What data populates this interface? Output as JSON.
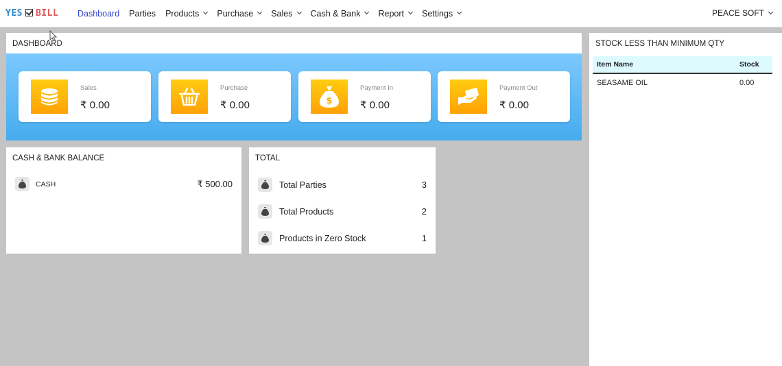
{
  "brand": {
    "yes": "YES",
    "bill": "BILL"
  },
  "nav": {
    "items": [
      {
        "label": "Dashboard",
        "dropdown": false,
        "active": true
      },
      {
        "label": "Parties",
        "dropdown": false,
        "active": false
      },
      {
        "label": "Products",
        "dropdown": true,
        "active": false
      },
      {
        "label": "Purchase",
        "dropdown": true,
        "active": false
      },
      {
        "label": "Sales",
        "dropdown": true,
        "active": false
      },
      {
        "label": "Cash & Bank",
        "dropdown": true,
        "active": false
      },
      {
        "label": "Report",
        "dropdown": true,
        "active": false
      },
      {
        "label": "Settings",
        "dropdown": true,
        "active": false
      }
    ],
    "company": "PEACE SOFT"
  },
  "dashboard": {
    "title": "DASHBOARD",
    "cards": [
      {
        "label": "Sales",
        "value": "₹ 0.00",
        "icon": "coins-stack-icon"
      },
      {
        "label": "Purchase",
        "value": "₹ 0.00",
        "icon": "basket-icon"
      },
      {
        "label": "Payment In",
        "value": "₹ 0.00",
        "icon": "money-bag-icon"
      },
      {
        "label": "Payment Out",
        "value": "₹ 0.00",
        "icon": "hand-card-icon"
      }
    ]
  },
  "cash_bank": {
    "title": "CASH & BANK BALANCE",
    "rows": [
      {
        "name": "CASH",
        "amount": "₹ 500.00"
      }
    ]
  },
  "total": {
    "title": "TOTAL",
    "rows": [
      {
        "name": "Total Parties",
        "count": "3"
      },
      {
        "name": "Total Products",
        "count": "2"
      },
      {
        "name": "Products in Zero Stock",
        "count": "1"
      }
    ]
  },
  "stock": {
    "title": "STOCK LESS THAN MINIMUM QTY",
    "columns": [
      "Item Name",
      "Stock"
    ],
    "rows": [
      {
        "item": "SEASAME OIL",
        "stock": "0.00"
      }
    ]
  },
  "colors": {
    "accent": "#3349c9",
    "icon_bg": "#ffb30a",
    "band": "#5ab8f5",
    "table_head": "#ddfbff"
  }
}
